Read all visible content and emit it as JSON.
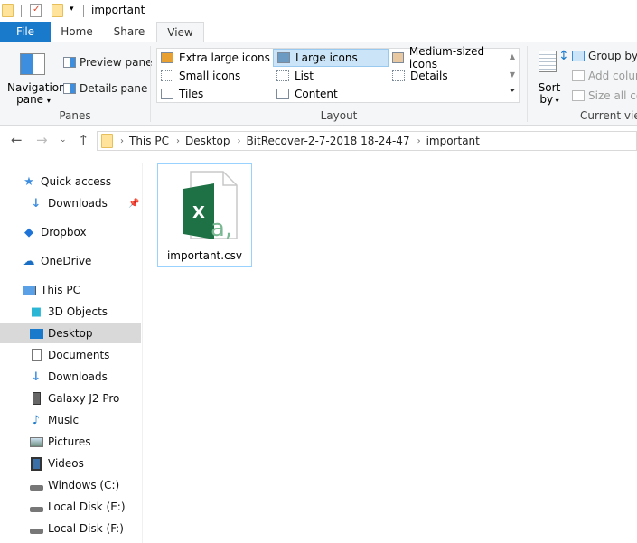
{
  "window": {
    "title": "important"
  },
  "quick_access_toolbar": {
    "icons": [
      "folder-icon",
      "properties-icon",
      "new-folder-icon",
      "customize-dropdown-icon"
    ]
  },
  "tabs": [
    {
      "label": "File",
      "state": "file"
    },
    {
      "label": "Home",
      "state": "normal"
    },
    {
      "label": "Share",
      "state": "normal"
    },
    {
      "label": "View",
      "state": "active"
    }
  ],
  "ribbon": {
    "panes": {
      "label": "Panes",
      "navigation_pane_line1": "Navigation",
      "navigation_pane_line2": "pane",
      "preview_pane": "Preview pane",
      "details_pane": "Details pane"
    },
    "layout": {
      "label": "Layout",
      "items": [
        {
          "label": "Extra large icons",
          "selected": false
        },
        {
          "label": "Small icons",
          "selected": false
        },
        {
          "label": "Tiles",
          "selected": false
        },
        {
          "label": "Large icons",
          "selected": true
        },
        {
          "label": "List",
          "selected": false
        },
        {
          "label": "Content",
          "selected": false
        },
        {
          "label": "Medium-sized icons",
          "selected": false
        },
        {
          "label": "Details",
          "selected": false
        }
      ]
    },
    "current_view": {
      "label": "Current view",
      "sort_by_line1": "Sort",
      "sort_by_line2": "by",
      "group_by": "Group by",
      "add_columns": "Add columns",
      "size_all_columns": "Size all columns"
    }
  },
  "address_bar": {
    "breadcrumbs": [
      "This PC",
      "Desktop",
      "BitRecover-2-7-2018 18-24-47",
      "important"
    ]
  },
  "nav_pane": {
    "items": [
      {
        "label": "Quick access",
        "icon": "quick-access-star-icon",
        "indent": 0,
        "selected": false
      },
      {
        "label": "Downloads",
        "icon": "downloads-arrow-icon",
        "indent": 1,
        "selected": false,
        "pinned": true
      },
      {
        "label": "Dropbox",
        "icon": "dropbox-icon",
        "indent": 0,
        "selected": false
      },
      {
        "label": "OneDrive",
        "icon": "onedrive-cloud-icon",
        "indent": 0,
        "selected": false
      },
      {
        "label": "This PC",
        "icon": "computer-icon",
        "indent": 0,
        "selected": false
      },
      {
        "label": "3D Objects",
        "icon": "3d-objects-icon",
        "indent": 1,
        "selected": false
      },
      {
        "label": "Desktop",
        "icon": "desktop-icon",
        "indent": 1,
        "selected": true
      },
      {
        "label": "Documents",
        "icon": "documents-icon",
        "indent": 1,
        "selected": false
      },
      {
        "label": "Downloads",
        "icon": "downloads-arrow-icon",
        "indent": 1,
        "selected": false
      },
      {
        "label": "Galaxy J2 Pro",
        "icon": "phone-icon",
        "indent": 1,
        "selected": false
      },
      {
        "label": "Music",
        "icon": "music-note-icon",
        "indent": 1,
        "selected": false
      },
      {
        "label": "Pictures",
        "icon": "pictures-icon",
        "indent": 1,
        "selected": false
      },
      {
        "label": "Videos",
        "icon": "videos-icon",
        "indent": 1,
        "selected": false
      },
      {
        "label": "Windows (C:)",
        "icon": "windows-drive-icon",
        "indent": 1,
        "selected": false
      },
      {
        "label": "Local Disk (E:)",
        "icon": "drive-icon",
        "indent": 1,
        "selected": false
      },
      {
        "label": "Local Disk (F:)",
        "icon": "drive-icon",
        "indent": 1,
        "selected": false
      }
    ]
  },
  "files": [
    {
      "name": "important.csv",
      "icon": "excel-csv-file-icon",
      "icon_letter": "X",
      "icon_suffix": "a,"
    }
  ],
  "colors": {
    "file_tab": "#1979ca",
    "selection": "#cce4f7",
    "nav_selected": "#d9d9d9",
    "excel_green": "#1e7145"
  }
}
